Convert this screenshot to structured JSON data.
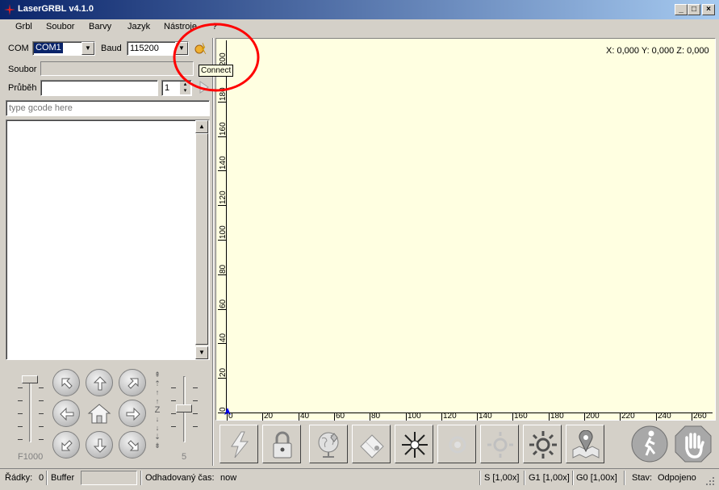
{
  "window": {
    "title": "LaserGRBL v4.1.0"
  },
  "menu": [
    "Grbl",
    "Soubor",
    "Barvy",
    "Jazyk",
    "Nástroje",
    "?"
  ],
  "connection": {
    "com_label": "COM",
    "com_value": "COM1",
    "baud_label": "Baud",
    "baud_value": "115200",
    "connect_tooltip": "Connect"
  },
  "file": {
    "label": "Soubor",
    "value": ""
  },
  "progress": {
    "label": "Průběh",
    "value": "",
    "count": "1"
  },
  "gcode_input": {
    "placeholder": "type gcode here"
  },
  "speed": {
    "feed_label": "F1000",
    "step_label": "5"
  },
  "jog": {
    "z_label": "Z"
  },
  "canvas": {
    "coords": "X: 0,000 Y: 0,000 Z: 0,000",
    "y_ticks": [
      "0",
      "20",
      "40",
      "60",
      "80",
      "100",
      "120",
      "140",
      "160",
      "180",
      "200"
    ],
    "x_ticks": [
      "0",
      "20",
      "40",
      "60",
      "80",
      "100",
      "120",
      "140",
      "160",
      "180",
      "200",
      "220",
      "240",
      "260"
    ]
  },
  "toolbar": [
    "reset-grbl",
    "unlock",
    "homing",
    "center",
    "laser-focus",
    "laser-off",
    "laser-low",
    "laser-high",
    "frame",
    "reset",
    "abort"
  ],
  "status": {
    "lines_label": "Řádky:",
    "lines_value": "0",
    "buffer_label": "Buffer",
    "eta_label": "Odhadovaný čas:",
    "eta_value": "now",
    "s_override": "S [1,00x]",
    "g1_override": "G1 [1,00x]",
    "g0_override": "G0 [1,00x]",
    "state_label": "Stav:",
    "state_value": "Odpojeno"
  },
  "colors": {
    "canvas_bg": "#ffffe1",
    "title_start": "#0a246a",
    "title_end": "#a6caf0",
    "annotation": "#ff0000"
  }
}
